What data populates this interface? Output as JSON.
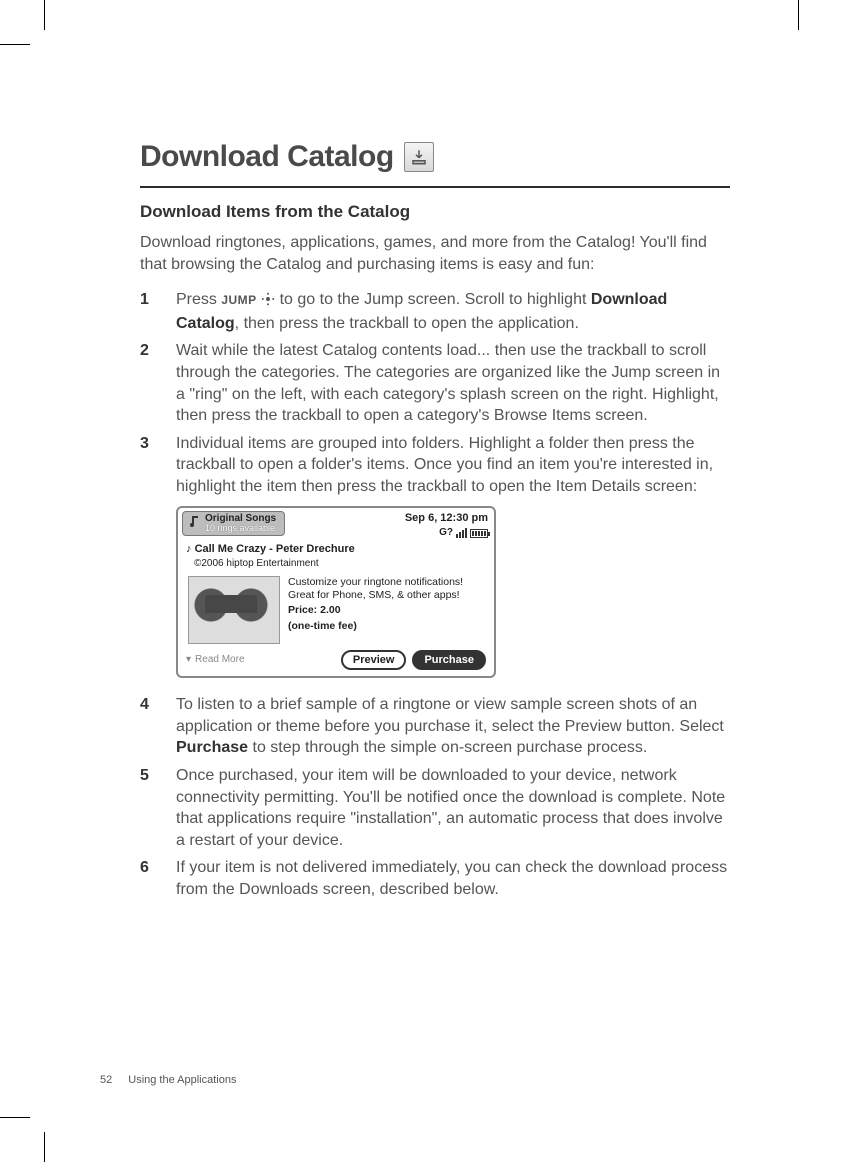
{
  "page": {
    "number": "52",
    "running_foot": "Using the Applications"
  },
  "heading": "Download Catalog",
  "icon_name": "catalog-download-icon",
  "subheading": "Download Items from the Catalog",
  "intro": "Download ringtones, applications, games, and more from the Catalog! You'll find that browsing the Catalog and purchasing items is easy and fun:",
  "steps": [
    {
      "n": "1",
      "pre": "Press ",
      "key": "JUMP",
      "post_icon": "jump-icon",
      "mid": " to go to the Jump screen. Scroll to highlight ",
      "bold": "Download Catalog",
      "tail": ", then press the trackball to open the application."
    },
    {
      "n": "2",
      "text": "Wait while the latest Catalog contents load... then use the trackball to scroll through the categories. The categories are organized like the Jump screen in a \"ring\" on the left, with each category's splash screen on the right. Highlight, then press the trackball to open a category's Browse Items screen."
    },
    {
      "n": "3",
      "text": "Individual items are grouped into folders. Highlight a folder then press the trackball to open a folder's items. Once you find an item you're interested in, highlight the item then press the trackball to open the Item Details screen:"
    },
    {
      "n": "4",
      "pre": "To listen to a brief sample of a ringtone or view sample screen shots of an application or theme before you purchase it, select the Preview button. Select ",
      "bold": "Purchase",
      "tail": " to step through the simple on-screen purchase process."
    },
    {
      "n": "5",
      "text": "Once purchased, your item will be downloaded to your device, network connectivity permitting. You'll be notified once the download is complete. Note that applications require \"installation\", an automatic process that does involve a restart of your device."
    },
    {
      "n": "6",
      "text": "If your item is not delivered immediately, you can check the download process from the Downloads screen, described below."
    }
  ],
  "screenshot": {
    "tab_title": "Original Songs",
    "tab_sub": "10 rings available",
    "time": "Sep 6, 12:30 pm",
    "network_label": "G?",
    "item_title": "Call Me Crazy - Peter Drechure",
    "copyright": "©2006 hiptop Entertainment",
    "description": "Customize your ringtone notifications! Great for Phone, SMS, & other apps!",
    "price_label": "Price: 2.00",
    "fee_note": "(one-time fee)",
    "read_more": "Read More",
    "preview_btn": "Preview",
    "purchase_btn": "Purchase"
  }
}
